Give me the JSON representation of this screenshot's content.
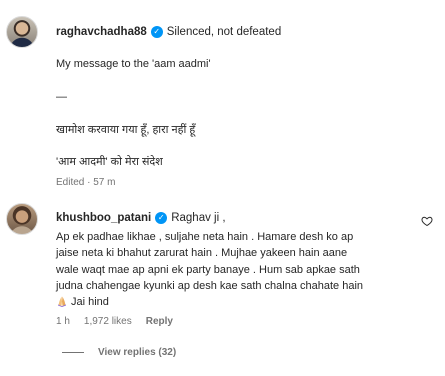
{
  "caption": {
    "username": "raghavchadha88",
    "lead_text": "Silenced, not defeated",
    "lines": [
      "My message to the 'aam aadmi'",
      "—",
      "खामोश करवाया गया हूँ, हारा नहीं हूँ",
      "'आम आदमी' को मेरा संदेश"
    ],
    "meta": "Edited · 57 m"
  },
  "comment": {
    "username": "khushboo_patani",
    "lead_text": "Raghav ji ,",
    "body_lines": [
      "Ap ek padhae likhae , suljahe neta hain . Hamare desh ko ap",
      "jaise neta ki bhahut zarurat hain . Mujhae yakeen hain aane",
      "wale waqt mae ap apni ek party banaye . Hum sab apkae sath",
      "judna chahengae kyunki ap desh kae sath chalna chahate hain",
      "Jai hind"
    ],
    "time": "1 h",
    "likes": "1,972 likes",
    "reply_label": "Reply",
    "view_replies": "View replies (32)",
    "emoji_icon": "folded-hands-emoji",
    "like_icon": "heart-outline-icon"
  },
  "colors": {
    "verified": "#0095f6",
    "text": "#262626",
    "secondary": "#737373"
  }
}
